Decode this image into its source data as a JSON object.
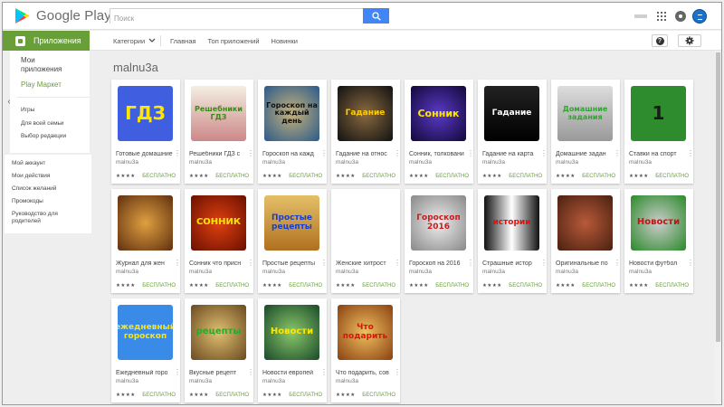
{
  "header": {
    "brand": "Google Play",
    "search_placeholder": "Поиск",
    "icons": [
      "search-icon",
      "apps-grid-icon",
      "notifications-icon",
      "account-avatar"
    ]
  },
  "subnav": {
    "apps_tab": "Приложения",
    "categories": "Категории",
    "items": [
      "Главная",
      "Топ приложений",
      "Новинки"
    ]
  },
  "sidebar": {
    "my_apps": "Мои приложения",
    "play_market": "Play Маркет",
    "links": [
      "Игры",
      "Для всей семьи",
      "Выбор редакции"
    ]
  },
  "sidebar_account": {
    "links": [
      "Мой аккаунт",
      "Мои действия",
      "Список желаний",
      "Промокоды",
      "Руководство для родителей"
    ]
  },
  "main": {
    "developer_title": "malnu3a",
    "price_label": "БЕСПЛАТНО",
    "apps": [
      {
        "title": "Готовые домашние",
        "dev": "malnu3a",
        "thumb_text": "ГДЗ"
      },
      {
        "title": "Решебники ГДЗ с",
        "dev": "malnu3a",
        "thumb_text": "Решебники ГДЗ"
      },
      {
        "title": "Гороскоп на кажд",
        "dev": "malnu3a",
        "thumb_text": "Гороскоп на каждый день"
      },
      {
        "title": "Гадание на относ",
        "dev": "malnu3a",
        "thumb_text": "Гадание"
      },
      {
        "title": "Сонник, толковани",
        "dev": "malnu3a",
        "thumb_text": "Сонник"
      },
      {
        "title": "Гадание на карта",
        "dev": "malnu3a",
        "thumb_text": "Гадание"
      },
      {
        "title": "Домашние задан",
        "dev": "malnu3a",
        "thumb_text": "Домашние задания"
      },
      {
        "title": "Ставки на спорт",
        "dev": "malnu3a",
        "thumb_text": "1"
      },
      {
        "title": "Журнал для жен",
        "dev": "malnu3a",
        "thumb_text": ""
      },
      {
        "title": "Сонник что присн",
        "dev": "malnu3a",
        "thumb_text": "СОННИК"
      },
      {
        "title": "Простые рецепты",
        "dev": "malnu3a",
        "thumb_text": "Простые рецепты"
      },
      {
        "title": "Женские хитрост",
        "dev": "malnu3a",
        "thumb_text": ""
      },
      {
        "title": "Гороскоп на 2016",
        "dev": "malnu3a",
        "thumb_text": "Гороскоп 2016"
      },
      {
        "title": "Страшные истор",
        "dev": "malnu3a",
        "thumb_text": "истории"
      },
      {
        "title": "Оригинальные по",
        "dev": "malnu3a",
        "thumb_text": ""
      },
      {
        "title": "Новости футбол",
        "dev": "malnu3a",
        "thumb_text": "Новости"
      },
      {
        "title": "Ежедневный горо",
        "dev": "malnu3a",
        "thumb_text": "ежедневный гороскоп"
      },
      {
        "title": "Вкусные рецепт",
        "dev": "malnu3a",
        "thumb_text": "рецепты"
      },
      {
        "title": "Новости европей",
        "dev": "malnu3a",
        "thumb_text": "Новости"
      },
      {
        "title": "Что подарить, сов",
        "dev": "malnu3a",
        "thumb_text": "Что подарить"
      }
    ]
  },
  "colors": {
    "accent_green": "#689f38",
    "search_blue": "#4285f4"
  }
}
